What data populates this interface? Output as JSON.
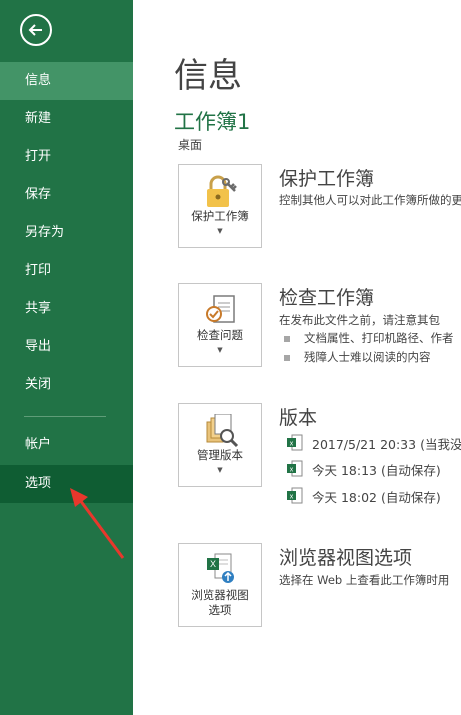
{
  "sidebar": {
    "items": [
      {
        "label": "信息"
      },
      {
        "label": "新建"
      },
      {
        "label": "打开"
      },
      {
        "label": "保存"
      },
      {
        "label": "另存为"
      },
      {
        "label": "打印"
      },
      {
        "label": "共享"
      },
      {
        "label": "导出"
      },
      {
        "label": "关闭"
      },
      {
        "label": "帐户"
      },
      {
        "label": "选项"
      }
    ],
    "selected": "信息",
    "highlighted": "选项"
  },
  "main": {
    "title": "信息",
    "workbook_name": "工作簿1",
    "location": "桌面",
    "sections": {
      "protect": {
        "button_label": "保护工作簿",
        "title": "保护工作簿",
        "description": "控制其他人可以对此工作簿所做的更"
      },
      "inspect": {
        "button_label": "检查问题",
        "title": "检查工作簿",
        "description": "在发布此文件之前，请注意其包",
        "bullets": [
          "文档属性、打印机路径、作者",
          "残障人士难以阅读的内容"
        ]
      },
      "versions": {
        "button_label": "管理版本",
        "title": "版本",
        "entries": [
          "2017/5/21 20:33 (当我没",
          "今天 18:13 (自动保存)",
          "今天 18:02 (自动保存)"
        ]
      },
      "browser": {
        "button_label_line1": "浏览器视图",
        "button_label_line2": "选项",
        "title": "浏览器视图选项",
        "description": "选择在 Web 上查看此工作簿时用"
      }
    }
  },
  "colors": {
    "sidebar": "#217346",
    "selected": "#439467",
    "highlighted": "#0f5d33",
    "accent": "#217346",
    "annotation_arrow": "#e8372c"
  }
}
